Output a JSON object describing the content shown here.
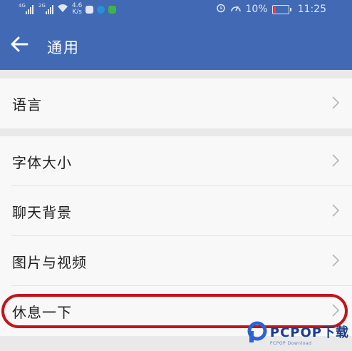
{
  "status_bar": {
    "signal1_label": "4G",
    "signal2_label": "2G",
    "net_speed_value": "4.6",
    "net_speed_unit": "K/s",
    "battery_percent": "10%",
    "time": "11:25"
  },
  "app_bar": {
    "title": "通用"
  },
  "settings": {
    "language": "语言",
    "font_size": "字体大小",
    "chat_background": "聊天背景",
    "photos_videos": "图片与视频",
    "take_a_break": "休息一下"
  },
  "watermark": {
    "main": "PCPOP下载",
    "sub": "PCPOP Download"
  },
  "colors": {
    "header": "#4169b4",
    "highlight": "#c4141b"
  }
}
